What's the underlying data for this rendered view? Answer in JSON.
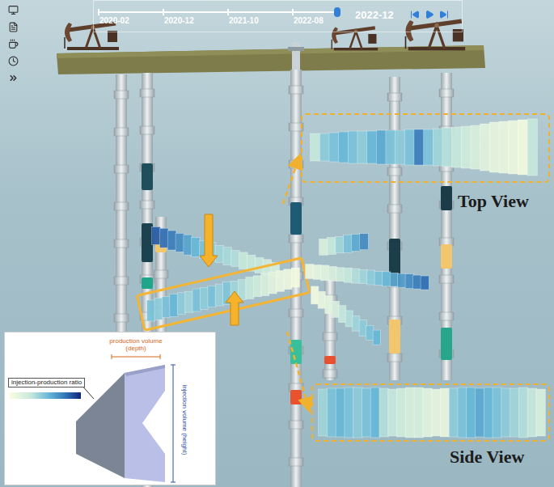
{
  "timeline": {
    "ticks": [
      "2020-02",
      "2020-12",
      "2021-10",
      "2022-08"
    ],
    "current": "2022-12",
    "level": 1
  },
  "wells": [
    {
      "segments": []
    },
    {
      "segments": [
        {
          "color": "#1f4e5c"
        },
        {
          "color": "#1c4250"
        },
        {
          "color": "#1ea58a"
        }
      ]
    },
    {
      "segments": [
        {
          "color": "#f2c66d"
        }
      ]
    },
    {
      "segments": [
        {
          "color": "#1f5b74"
        },
        {
          "color": "#38bf9c"
        },
        {
          "color": "#e8522c"
        }
      ]
    },
    {
      "segments": [
        {
          "color": "#e9502f"
        }
      ]
    },
    {
      "segments": [
        {
          "color": "#1c3e4a"
        },
        {
          "color": "#f2c66d"
        }
      ]
    },
    {
      "segments": [
        {
          "color": "#1b3c48"
        },
        {
          "color": "#f2c66d"
        },
        {
          "color": "#27a68b"
        }
      ]
    }
  ],
  "glyphs": [
    {
      "highlighted": false,
      "ratio": [
        0.85,
        0.8,
        0.75,
        0.7,
        0.62,
        0.55,
        0.5,
        0.45,
        0.4,
        0.38,
        0.35,
        0.3,
        0.3,
        0.28,
        0.25,
        0.22
      ],
      "injection": [
        22,
        24,
        24,
        23,
        25,
        24,
        22,
        23,
        21,
        22,
        20,
        21,
        20,
        19,
        20,
        18
      ]
    },
    {
      "highlighted": true,
      "ratio": [
        0.5,
        0.45,
        0.5,
        0.55,
        0.45,
        0.4,
        0.5,
        0.45,
        0.5,
        0.42,
        0.48,
        0.4,
        0.35,
        0.3,
        0.25,
        0.2,
        0.15,
        0.1,
        0.08,
        0.05
      ],
      "injection": [
        26,
        27,
        26,
        28,
        27,
        26,
        28,
        27,
        26,
        27,
        28,
        26,
        25,
        27,
        26,
        28,
        27,
        26,
        25,
        24
      ]
    },
    {
      "highlighted": false,
      "ratio": [
        0.1,
        0.12,
        0.15,
        0.2,
        0.25,
        0.3,
        0.35,
        0.4,
        0.45,
        0.5,
        0.55,
        0.6,
        0.65,
        0.7,
        0.75,
        0.8
      ],
      "injection": [
        18,
        18,
        19,
        18,
        17,
        18,
        18,
        17,
        18,
        17,
        18,
        17,
        17,
        18,
        17,
        17
      ]
    },
    {
      "highlighted": false,
      "ratio": [
        0.05,
        0.1,
        0.15,
        0.2,
        0.3,
        0.35,
        0.4,
        0.45,
        0.5,
        0.55
      ],
      "injection": [
        22,
        21,
        22,
        20,
        21,
        20,
        19,
        20,
        18,
        18
      ]
    },
    {
      "highlighted": false,
      "ratio": [
        0.2,
        0.3,
        0.4,
        0.5,
        0.6,
        0.7
      ],
      "injection": [
        20,
        21,
        20,
        22,
        21,
        20
      ]
    }
  ],
  "views": [
    {
      "label": "Top View",
      "ratio": [
        0.3,
        0.45,
        0.5,
        0.55,
        0.5,
        0.45,
        0.55,
        0.6,
        0.5,
        0.45,
        0.5,
        0.75,
        0.5,
        0.4,
        0.35,
        0.3,
        0.25,
        0.2,
        0.15,
        0.12,
        0.1,
        0.08,
        0.05,
        0.3
      ],
      "injection": [
        34,
        34,
        36,
        38,
        40,
        40,
        40,
        42,
        42,
        42,
        44,
        44,
        44,
        46,
        48,
        50,
        52,
        54,
        58,
        62,
        64,
        66,
        68,
        70
      ]
    },
    {
      "label": "Side View",
      "ratio": [
        0.4,
        0.5,
        0.55,
        0.5,
        0.45,
        0.5,
        0.55,
        0.35,
        0.3,
        0.25,
        0.2,
        0.2,
        0.15,
        0.12,
        0.1,
        0.45,
        0.5,
        0.55,
        0.6,
        0.55,
        0.5,
        0.45,
        0.4,
        0.35,
        0.3,
        0.2
      ],
      "injection": [
        58,
        60,
        60,
        62,
        62,
        60,
        62,
        60,
        58,
        60,
        62,
        62,
        60,
        58,
        60,
        60,
        62,
        62,
        60,
        62,
        62,
        60,
        60,
        62,
        60,
        58
      ]
    }
  ],
  "legend": {
    "production": "production volume",
    "production_unit": "(depth)",
    "ratio": "injection-production ratio",
    "injection": "injection volume (height)"
  }
}
